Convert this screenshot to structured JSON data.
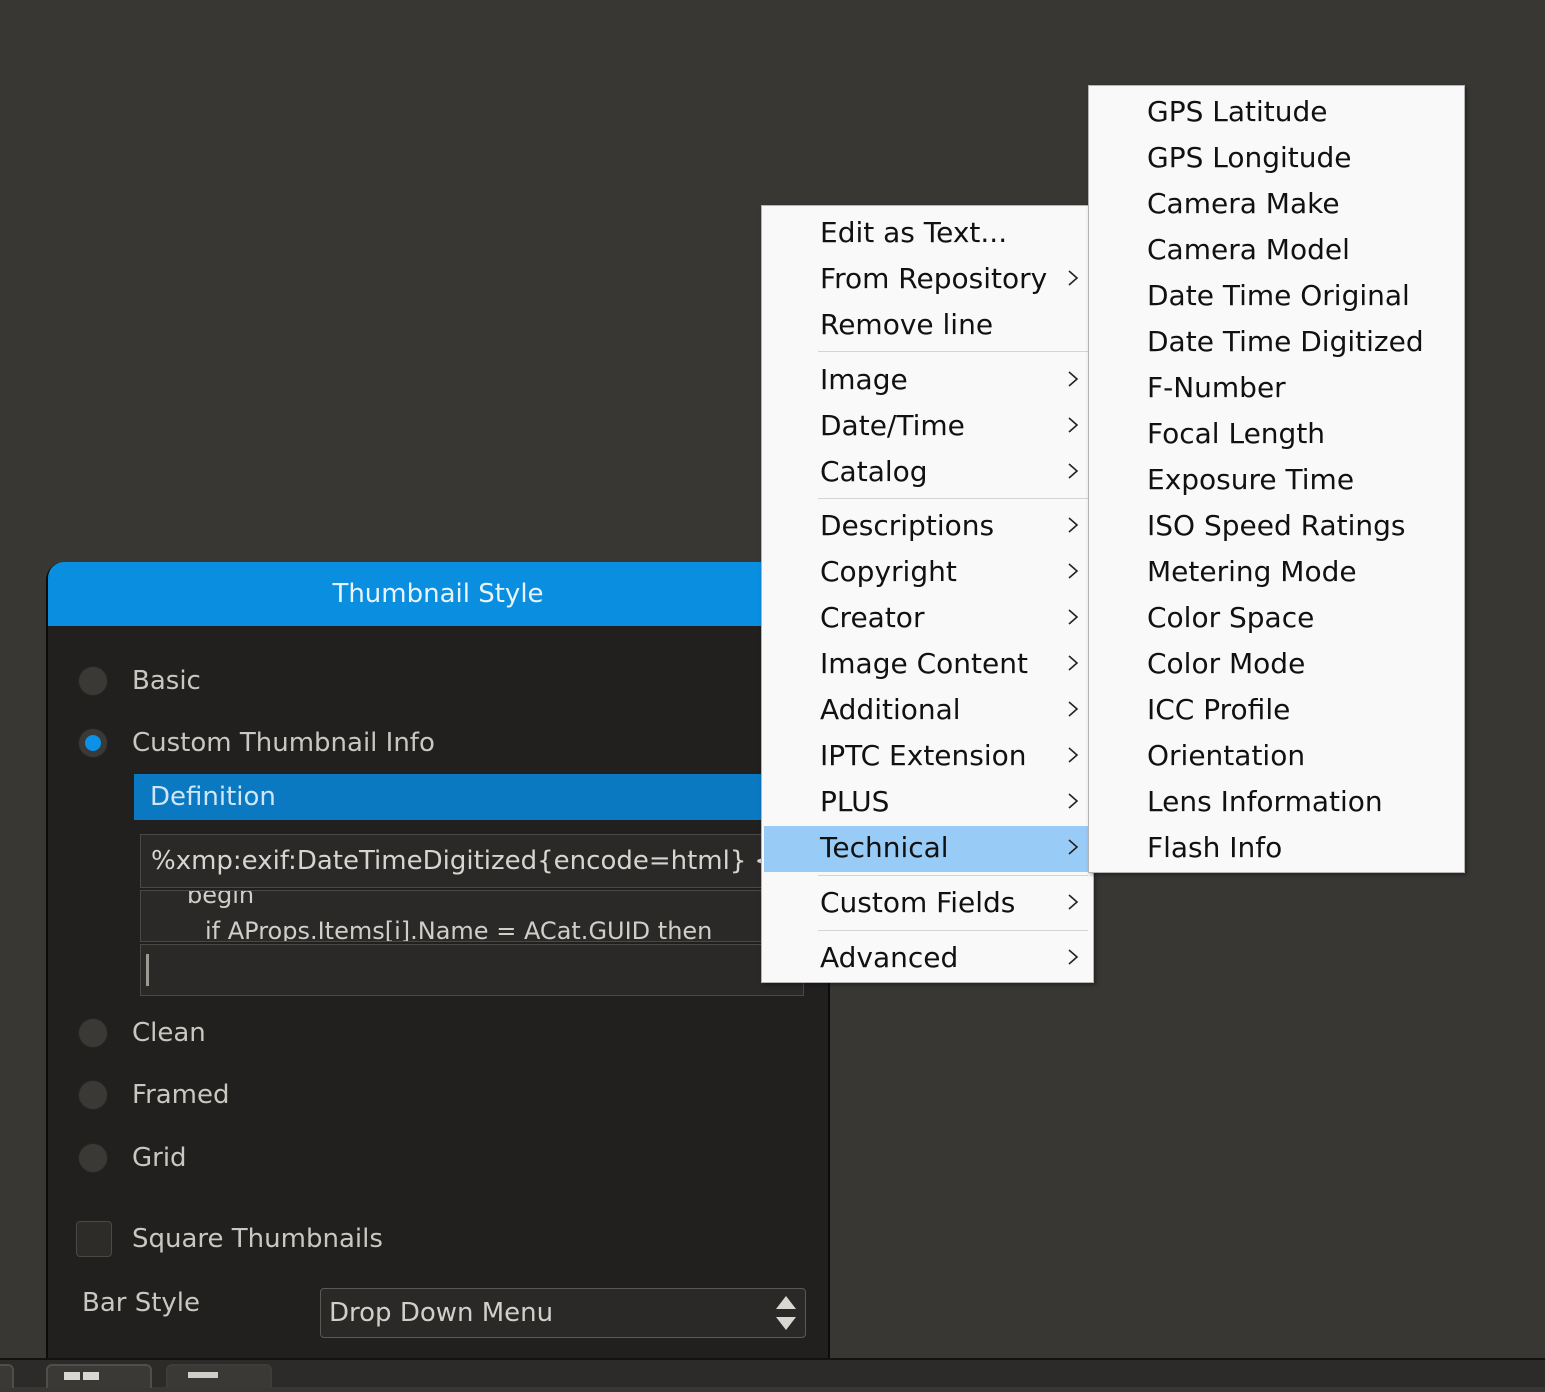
{
  "panel": {
    "title": "Thumbnail Style",
    "styles": [
      {
        "label": "Basic",
        "selected": false
      },
      {
        "label": "Custom Thumbnail Info",
        "selected": true
      },
      {
        "label": "Clean",
        "selected": false
      },
      {
        "label": "Framed",
        "selected": false
      },
      {
        "label": "Grid",
        "selected": false
      }
    ],
    "definition_header": "Definition",
    "definition_line": "%xmp:exif:DateTimeDigitized{encode=html} <",
    "code_line1": "begin",
    "code_line2": "if AProps.Items[i].Name = ACat.GUID then",
    "square_thumbnails_label": "Square Thumbnails",
    "square_thumbnails_checked": false,
    "bar_style_label": "Bar Style",
    "bar_style_value": "Drop Down Menu"
  },
  "menu": {
    "items": [
      {
        "label": "Edit as Text...",
        "submenu": false
      },
      {
        "label": "From Repository",
        "submenu": true
      },
      {
        "label": "Remove line",
        "submenu": false
      },
      {
        "label": "Image",
        "submenu": true
      },
      {
        "label": "Date/Time",
        "submenu": true
      },
      {
        "label": "Catalog",
        "submenu": true
      },
      {
        "label": "Descriptions",
        "submenu": true
      },
      {
        "label": "Copyright",
        "submenu": true
      },
      {
        "label": "Creator",
        "submenu": true
      },
      {
        "label": "Image Content",
        "submenu": true
      },
      {
        "label": "Additional",
        "submenu": true
      },
      {
        "label": "IPTC Extension",
        "submenu": true
      },
      {
        "label": "PLUS",
        "submenu": true
      },
      {
        "label": "Technical",
        "submenu": true,
        "highlighted": true
      },
      {
        "label": "Custom Fields",
        "submenu": true
      },
      {
        "label": "Advanced",
        "submenu": true
      }
    ],
    "highlight_color": "#99cbf7"
  },
  "submenu": {
    "items": [
      "GPS Latitude",
      "GPS Longitude",
      "Camera Make",
      "Camera Model",
      "Date Time Original",
      "Date Time Digitized",
      "F-Number",
      "Focal Length",
      "Exposure Time",
      "ISO Speed Ratings",
      "Metering Mode",
      "Color Space",
      "Color Mode",
      "ICC Profile",
      "Orientation",
      "Lens Information",
      "Flash Info"
    ]
  },
  "colors": {
    "accent": "#0a8ee0",
    "background": "#383734",
    "panel": "#21201e"
  }
}
